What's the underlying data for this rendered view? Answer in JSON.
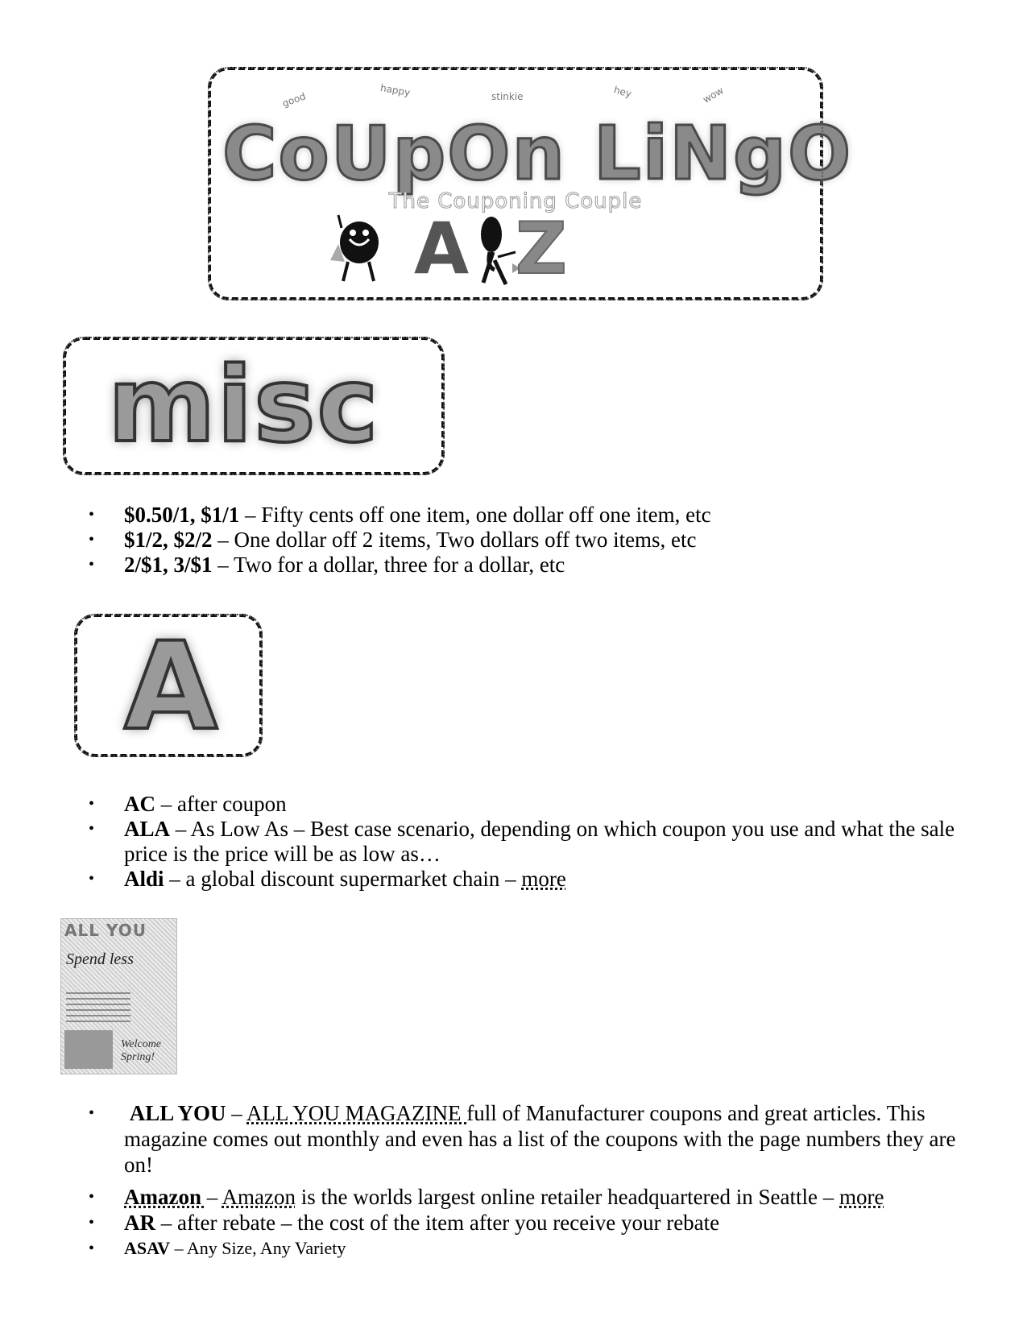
{
  "banner": {
    "title": "CoUpOn LiNgO",
    "subtitle": "The Couponing Couple",
    "letter_start": "A",
    "letter_end": "Z",
    "decorative_words": [
      "good",
      "happy",
      "stinkie",
      "hey",
      "wow"
    ]
  },
  "sections": {
    "misc": {
      "heading": "misc",
      "items": [
        {
          "term": "$0.50/1, $1/1",
          "text": " – Fifty cents off one item, one dollar off one item, etc"
        },
        {
          "term": "$1/2, $2/2",
          "text": " – One dollar off 2 items, Two dollars off two items, etc"
        },
        {
          "term": "2/$1, 3/$1",
          "text": " – Two for a dollar, three for a dollar, etc"
        }
      ]
    },
    "a": {
      "heading": "A",
      "items": [
        {
          "term": "AC",
          "text": " – after coupon"
        },
        {
          "term": "ALA",
          "text": " – As Low As – Best case scenario, depending on which coupon you use and what the sale price is the price will be as low as…"
        },
        {
          "term": "Aldi",
          "text": " – a global discount supermarket chain – ",
          "link": "more"
        }
      ],
      "magazine_image": {
        "masthead": "ALL YOU",
        "headline": "Spend less",
        "footer": "Welcome Spring!"
      },
      "items_2": {
        "all_you": {
          "term": "ALL YOU",
          "sep": " – ",
          "link": "ALL YOU MAGAZINE ",
          "text": "full of Manufacturer coupons and great articles. This magazine comes out monthly and even has a list of the coupons with the page numbers they are on!"
        },
        "amazon": {
          "term": "Amazon ",
          "sep": "– ",
          "link": "Amazon",
          "text": " is the worlds largest online retailer headquartered in Seattle – ",
          "link2": "more"
        },
        "ar": {
          "term": "AR",
          "text": " – after rebate – the cost of the item after you receive your rebate"
        },
        "asav": {
          "term": "ASAV",
          "text": " – Any Size, Any Variety"
        }
      }
    }
  }
}
